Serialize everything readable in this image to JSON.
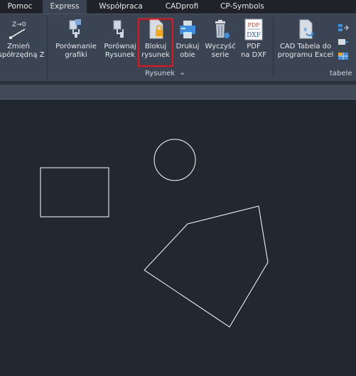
{
  "tabs": [
    {
      "label": "Pomoc",
      "active": false
    },
    {
      "label": "Express",
      "active": true
    },
    {
      "label": "Współpraca",
      "active": false
    },
    {
      "label": "CADprofi",
      "active": false
    },
    {
      "label": "CP-Symbols",
      "active": false
    }
  ],
  "ribbon": {
    "buttons": {
      "zmien": {
        "line1": "Zmień",
        "line2": "współrzędną Z",
        "icon": "z-coordinate-icon"
      },
      "porownanie_grafiki": {
        "line1": "Porównanie",
        "line2": "grafiki",
        "icon": "compare-graphics-icon"
      },
      "porownaj_rysunek": {
        "line1": "Porównaj",
        "line2": "Rysunek",
        "icon": "compare-drawing-icon"
      },
      "blokuj_rysunek": {
        "line1": "Blokuj",
        "line2": "rysunek",
        "icon": "lock-drawing-icon"
      },
      "drukuj_obie": {
        "line1": "Drukuj",
        "line2": "obie",
        "icon": "print-icon"
      },
      "wyczysc_serie": {
        "line1": "Wyczyść",
        "line2": "serie",
        "icon": "trash-icon"
      },
      "pdf_na_dxf": {
        "line1": "PDF",
        "line2": "na DXF",
        "icon": "pdf-to-dxf-icon"
      },
      "cad_tabela": {
        "line1": "CAD Tabela do",
        "line2": "programu Excel",
        "icon": "excel-table-icon"
      }
    },
    "icon_z_label": "Z→0",
    "pdf_icon_top": "PDF",
    "pdf_icon_bottom": "DXF",
    "groups": {
      "rysunek": "Rysunek",
      "tabele": "tabele"
    },
    "expander_glyph": "⌄"
  },
  "canvas": {
    "background": "#212830",
    "stroke": "#ffffff",
    "shapes": [
      "rectangle",
      "circle",
      "pentagon"
    ]
  },
  "colors": {
    "tab_bar": "#1f2329",
    "ribbon": "#3b4453",
    "highlight": "#e8141a"
  }
}
